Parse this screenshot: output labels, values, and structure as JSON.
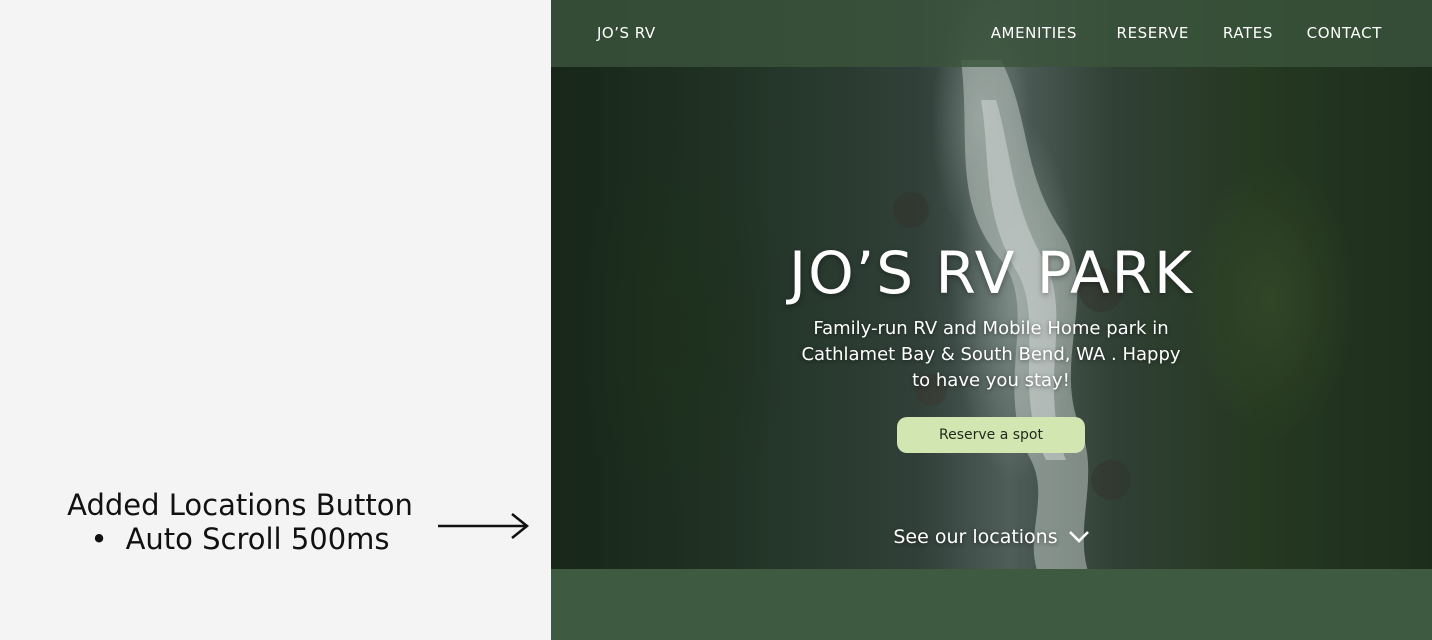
{
  "annotation": {
    "title": "Added Locations Button",
    "bullet": "Auto Scroll 500ms",
    "arrow_icon": "arrow-right-icon"
  },
  "site": {
    "brand": "JO’S RV",
    "nav": [
      "AMENITIES",
      "RESERVE",
      "RATES",
      "CONTACT"
    ],
    "hero": {
      "title": "JO’S RV PARK",
      "subtitle": "Family-run RV and Mobile Home park in Cathlamet Bay & South Bend, WA . Happy to have you stay!",
      "cta_label": "Reserve a spot",
      "locations_label": "See our locations",
      "locations_icon": "chevron-down-icon"
    },
    "colors": {
      "topbar": "#3a543c",
      "cta_bg": "#d1e6b1",
      "section_bg": "#3e5a40",
      "panel_bg": "#f4f4f4"
    }
  }
}
